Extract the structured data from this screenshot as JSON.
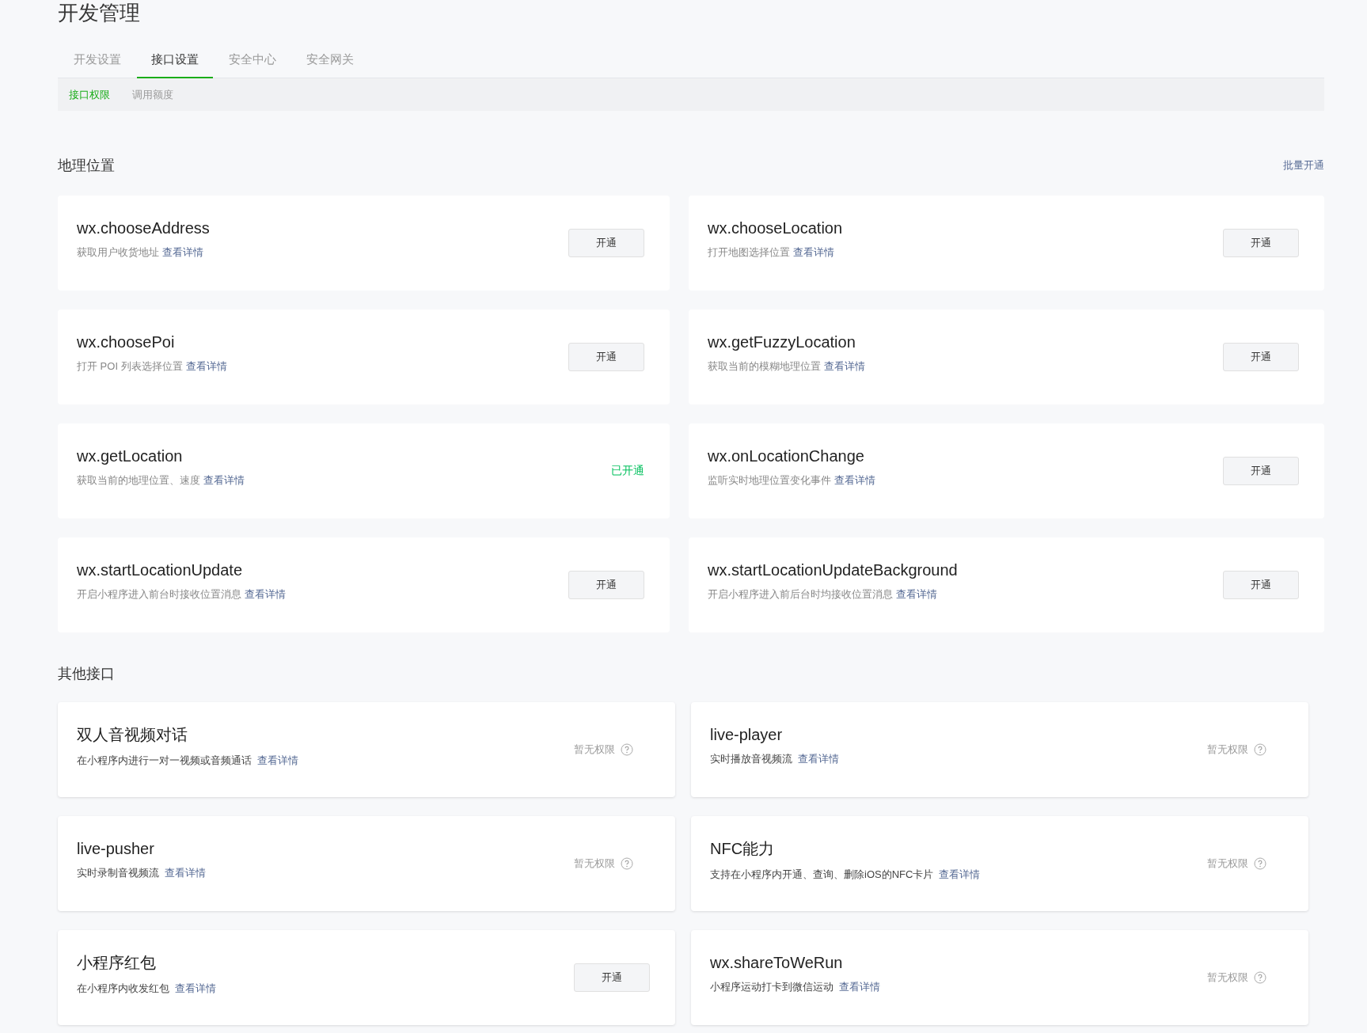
{
  "page_title": "开发管理",
  "tabs": [
    {
      "label": "开发设置",
      "selected": false
    },
    {
      "label": "接口设置",
      "selected": true
    },
    {
      "label": "安全中心",
      "selected": false
    },
    {
      "label": "安全网关",
      "selected": false
    }
  ],
  "subtabs": [
    {
      "label": "接口权限",
      "selected": true
    },
    {
      "label": "调用额度",
      "selected": false
    }
  ],
  "sections": [
    {
      "title": "地理位置",
      "kind": "plain",
      "action": "批量开通",
      "cards": [
        {
          "name": "wx.chooseAddress",
          "description": "获取用户收货地址",
          "link": "查看详情",
          "kind": "button",
          "status": "开通"
        },
        {
          "name": "wx.chooseLocation",
          "description": "打开地图选择位置",
          "link": "查看详情",
          "kind": "button",
          "status": "开通"
        },
        {
          "name": "wx.choosePoi",
          "description": "打开 POI 列表选择位置",
          "link": "查看详情",
          "kind": "button",
          "status": "开通"
        },
        {
          "name": "wx.getFuzzyLocation",
          "description": "获取当前的模糊地理位置",
          "link": "查看详情",
          "kind": "button",
          "status": "开通"
        },
        {
          "name": "wx.getLocation",
          "description": "获取当前的地理位置、速度",
          "link": "查看详情",
          "kind": "enabled",
          "status": "已开通"
        },
        {
          "name": "wx.onLocationChange",
          "description": "监听实时地理位置变化事件",
          "link": "查看详情",
          "kind": "button",
          "status": "开通"
        },
        {
          "name": "wx.startLocationUpdate",
          "description": "开启小程序进入前台时接收位置消息",
          "link": "查看详情",
          "kind": "button",
          "status": "开通"
        },
        {
          "name": "wx.startLocationUpdateBackground",
          "description": "开启小程序进入前后台时均接收位置消息",
          "link": "查看详情",
          "kind": "button",
          "status": "开通"
        }
      ]
    },
    {
      "title": "其他接口",
      "kind": "raised",
      "cards": [
        {
          "name": "双人音视频对话",
          "description": "在小程序内进行一对一视频或音频通话",
          "link": "查看详情",
          "kind": "no_permission",
          "status": "暂无权限"
        },
        {
          "name": "live-player",
          "description": "实时播放音视频流",
          "link": "查看详情",
          "kind": "no_permission",
          "status": "暂无权限"
        },
        {
          "name": "live-pusher",
          "description": "实时录制音视频流",
          "link": "查看详情",
          "kind": "no_permission",
          "status": "暂无权限"
        },
        {
          "name": "NFC能力",
          "description": "支持在小程序内开通、查询、删除iOS的NFC卡片",
          "link": "查看详情",
          "kind": "no_permission",
          "status": "暂无权限"
        },
        {
          "name": "小程序红包",
          "description": "在小程序内收发红包",
          "link": "查看详情",
          "kind": "button",
          "status": "开通"
        },
        {
          "name": "wx.shareToWeRun",
          "description": "小程序运动打卡到微信运动",
          "link": "查看详情",
          "kind": "no_permission",
          "status": "暂无权限"
        }
      ]
    }
  ]
}
